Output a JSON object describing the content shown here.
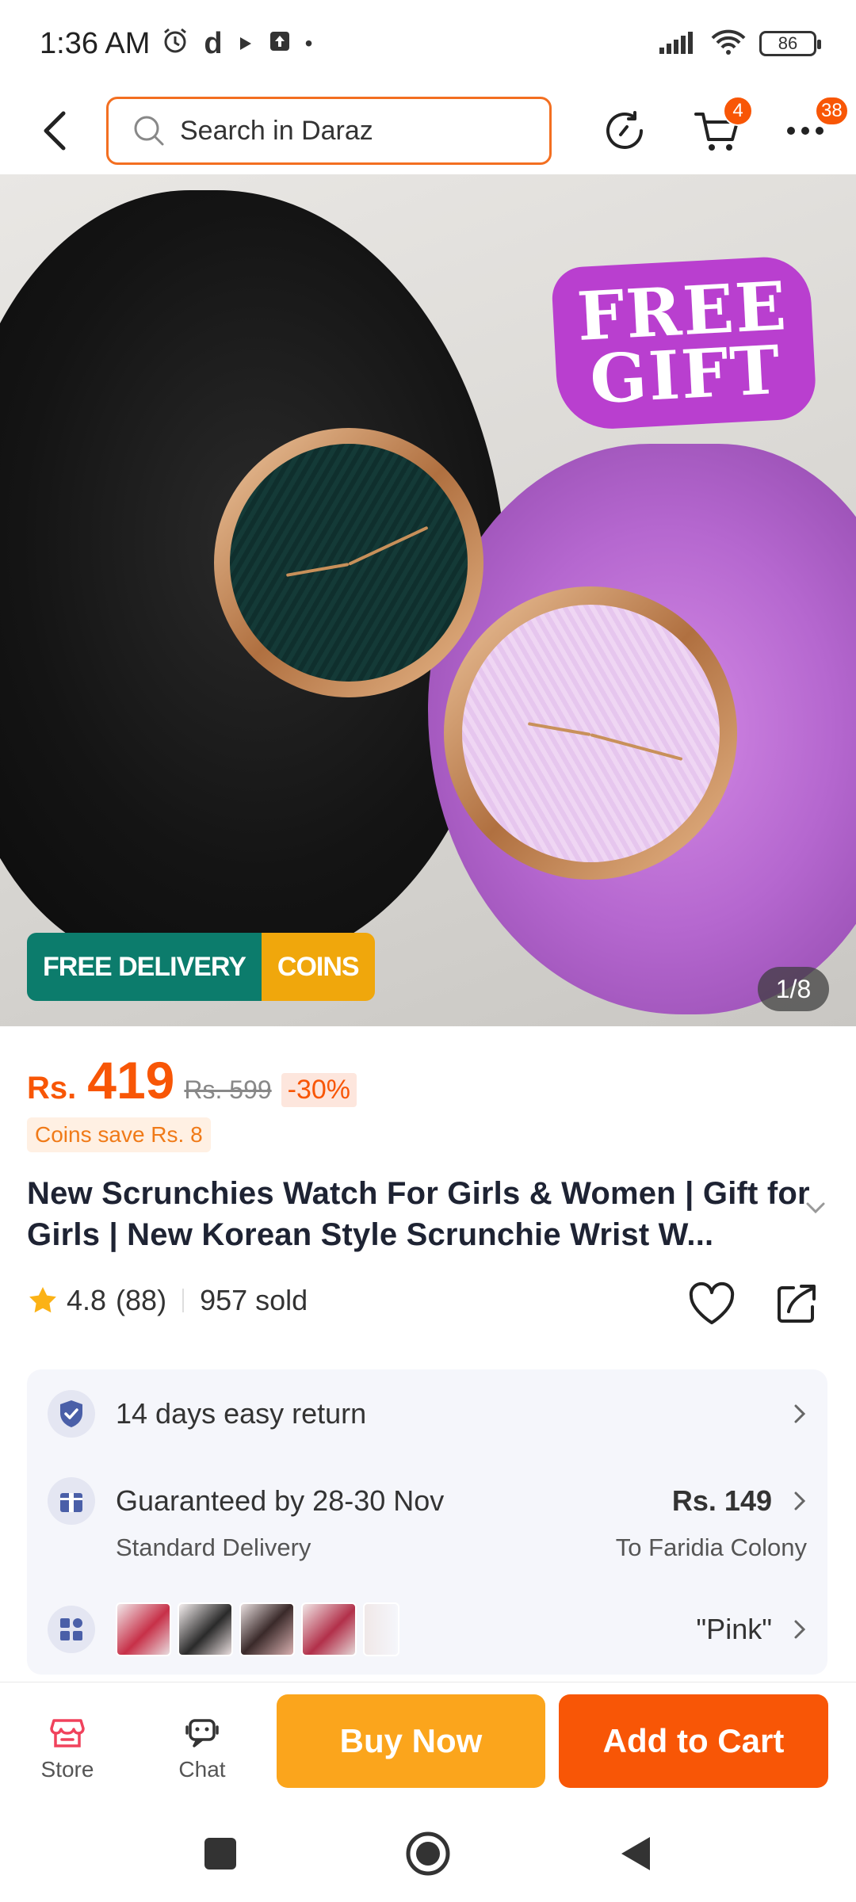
{
  "status_bar": {
    "time": "1:36 AM",
    "icons": [
      "alarm-icon",
      "daraz-d-icon",
      "play-icon",
      "upload-icon",
      "dot-icon"
    ],
    "battery": "86"
  },
  "top_nav": {
    "search_placeholder": "Search in Daraz",
    "cart_badge": "4",
    "more_badge": "38"
  },
  "hero": {
    "free_gift_line1": "FREE",
    "free_gift_line2": "GIFT",
    "tag_free_delivery": "FREE DELIVERY",
    "tag_coins": "COINS",
    "counter": "1/8"
  },
  "product": {
    "currency": "Rs.",
    "price": "419",
    "old_price": "Rs. 599",
    "discount": "-30%",
    "coins_save": "Coins save Rs. 8",
    "title": "New Scrunchies Watch For Girls & Women | Gift for Girls | New Korean Style Scrunchie Wrist W...",
    "rating": "4.8",
    "reviews": "(88)",
    "sold": "957 sold"
  },
  "info": {
    "return": "14 days easy return",
    "guarantee": "Guaranteed by 28-30 Nov",
    "delivery_type": "Standard Delivery",
    "delivery_price": "Rs. 149",
    "delivery_location": "To Faridia Colony",
    "variant": "\"Pink\""
  },
  "actions": {
    "store": "Store",
    "chat": "Chat",
    "buy_now": "Buy Now",
    "add_to_cart": "Add to Cart"
  },
  "colors": {
    "accent": "#f85606",
    "buy_now": "#fba51c",
    "delivery_tag": "#0c7c6c",
    "coins_tag": "#f0a70c"
  }
}
